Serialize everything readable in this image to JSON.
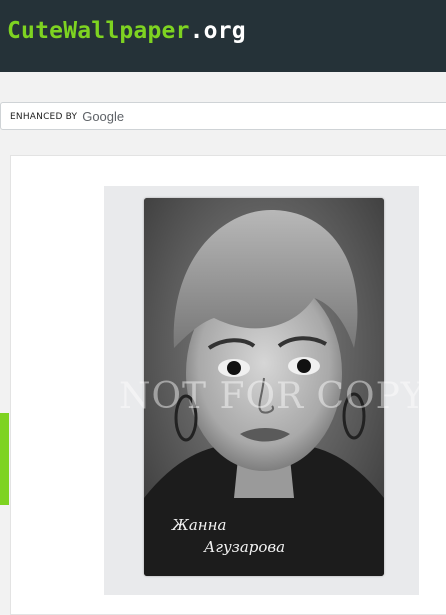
{
  "header": {
    "logo_brand": "CuteWallpaper",
    "logo_tld": ".org"
  },
  "search": {
    "branding_label": "ENHANCED BY",
    "branding_provider": "Google"
  },
  "main": {
    "watermark_text": "NOT FOR COPY",
    "signature_text": "Жанна Агузарова"
  },
  "colors": {
    "header_bg": "#253238",
    "brand_green": "#7ed321",
    "side_tab": "#7ed321"
  },
  "icons": [
    "side-tab-handle"
  ]
}
